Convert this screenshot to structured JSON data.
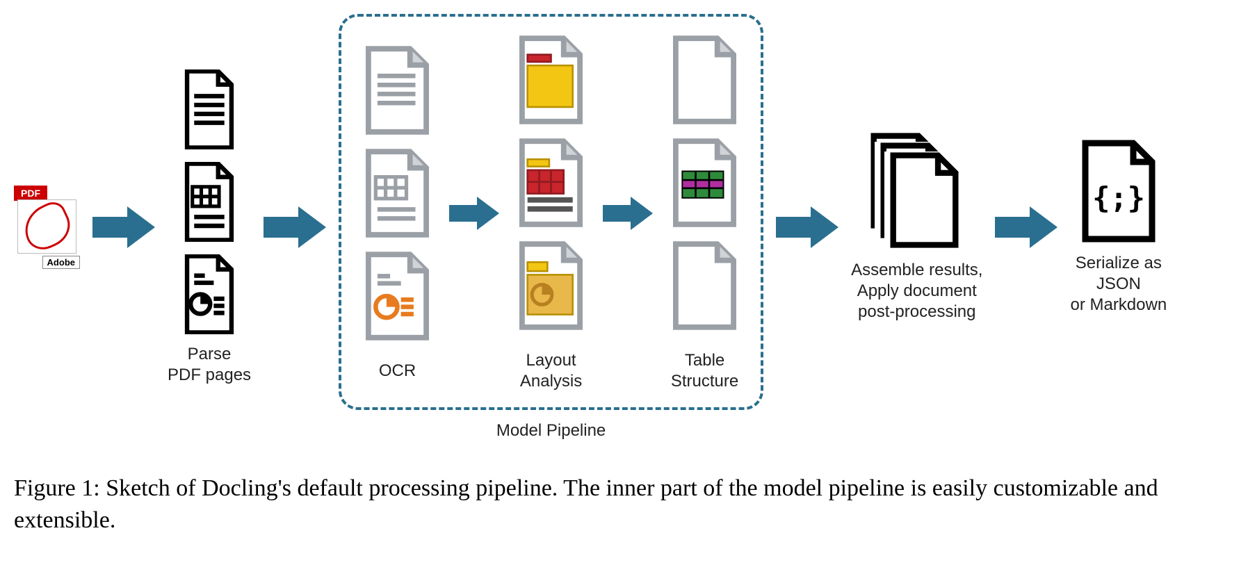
{
  "stages": {
    "parse": {
      "label": "Parse\nPDF pages"
    },
    "ocr": {
      "label": "OCR"
    },
    "layout": {
      "label": "Layout\nAnalysis"
    },
    "table": {
      "label": "Table\nStructure"
    },
    "assemble": {
      "label": "Assemble results,\nApply document\npost-processing"
    },
    "serialize": {
      "label": "Serialize as\nJSON\nor Markdown",
      "glyph": "{ ; }"
    }
  },
  "pipeline_label": "Model Pipeline",
  "pdf": {
    "badge": "PDF",
    "brand": "Adobe"
  },
  "caption": "Figure 1:  Sketch of Docling's default processing pipeline.  The inner part of the model pipeline is easily customizable and extensible.",
  "colors": {
    "arrow": "#2a6f8f",
    "dash": "#2a6f8f",
    "gray": "#9aa0a6",
    "yellow": "#f3c613",
    "red": "#c8252c",
    "orange": "#e87b1f",
    "green": "#2e8b3b",
    "magenta": "#b02fa0"
  }
}
